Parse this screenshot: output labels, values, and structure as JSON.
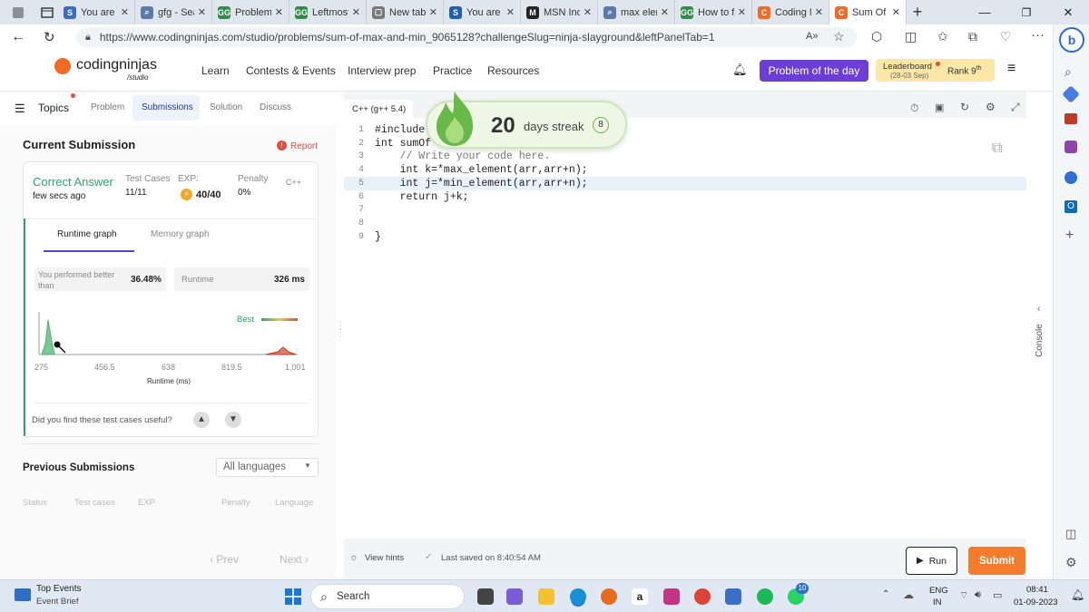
{
  "browser": {
    "tabs": [
      {
        "title": "You are s",
        "icon": "s-icon",
        "color": "#3b6cc4"
      },
      {
        "title": "gfg - Sea",
        "icon": "search-icon",
        "color": "#5a7aa8"
      },
      {
        "title": "Problem",
        "icon": "gfg-icon",
        "color": "#2f8d46"
      },
      {
        "title": "Leftmost",
        "icon": "gfg-icon",
        "color": "#2f8d46"
      },
      {
        "title": "New tab",
        "icon": "newtab-icon",
        "color": "#777777"
      },
      {
        "title": "You are s",
        "icon": "s-icon",
        "color": "#1d5fb3"
      },
      {
        "title": "MSN Ind",
        "icon": "msn-icon",
        "color": "#222222"
      },
      {
        "title": "max elen",
        "icon": "search-icon",
        "color": "#5a7aa8"
      },
      {
        "title": "How to f",
        "icon": "gfg-icon",
        "color": "#2f8d46"
      },
      {
        "title": "Coding N",
        "icon": "codingninjas-icon",
        "color": "#f26a24"
      },
      {
        "title": "Sum Of M",
        "icon": "codingninjas-icon",
        "color": "#f26a24",
        "active": true
      }
    ],
    "url": "https://www.codingninjas.com/studio/problems/sum-of-max-and-min_9065128?challengeSlug=ninja-slayground&leftPanelTab=1"
  },
  "site": {
    "brand": "codingninjas",
    "brand_sub": "/studio",
    "nav": [
      "Learn",
      "Contests & Events",
      "Interview prep",
      "Practice",
      "Resources"
    ],
    "potd_label": "Problem of the day",
    "leaderboard_label": "Leaderboard",
    "leaderboard_date": "(28-03 Sep)",
    "rank_label": "Rank 9",
    "rank_suffix": "th",
    "accent": "#6b3fd6",
    "orange": "#f57c2c"
  },
  "left": {
    "topics_label": "Topics",
    "tabs": [
      "Problem",
      "Submissions",
      "Solution",
      "Discuss"
    ],
    "active_tab": "Submissions",
    "current_title": "Current Submission",
    "report_label": "Report",
    "result": "Correct Answer",
    "time_ago": "few secs ago",
    "test_cases_label": "Test Cases",
    "test_cases_value": "11/11",
    "exp_label": "EXP:",
    "exp_value": "40/40",
    "penalty_label": "Penalty",
    "penalty_value": "0%",
    "language": "C++",
    "graph_tabs": [
      "Runtime graph",
      "Memory graph"
    ],
    "performed_label": "You performed better than",
    "performed_value": "36.48%",
    "runtime_label": "Runtime",
    "runtime_value": "326 ms",
    "best_label": "Best",
    "x_ticks": [
      "275",
      "456.5",
      "638",
      "819.5",
      "1,001"
    ],
    "x_axis_label": "Runtime (ms)",
    "feedback_label": "Did you find these test cases useful?",
    "previous_title": "Previous Submissions",
    "lang_filter": "All languages",
    "prev_columns": [
      "Status",
      "Test cases",
      "EXP",
      "Penalty",
      "Language"
    ],
    "prev_label": "Prev",
    "next_label": "Next"
  },
  "editor": {
    "language_label": "C++ (g++ 5.4)",
    "line_numbers": [
      "1",
      "2",
      "3",
      "4",
      "5",
      "6",
      "7",
      "8",
      "9"
    ],
    "lines": [
      "#include",
      "int sumOf",
      "    // Write your code here.",
      "    int k=*max_element(arr,arr+n);",
      "    int j=*min_element(arr,arr+n);",
      "    return j+k;",
      "",
      "",
      "}"
    ],
    "streak_value": "20",
    "streak_label": "days streak",
    "streak_badge": "8",
    "view_hints": "View hints",
    "last_saved": "Last saved on 8:40:54 AM",
    "run_label": "Run",
    "submit_label": "Submit",
    "console_label": "Console"
  },
  "taskbar": {
    "weather_title": "Top Events",
    "weather_sub": "Event Brief",
    "search_placeholder": "Search",
    "lang_top": "ENG",
    "lang_bottom": "IN",
    "time": "08:41",
    "date": "01-09-2023",
    "badge": "10"
  }
}
